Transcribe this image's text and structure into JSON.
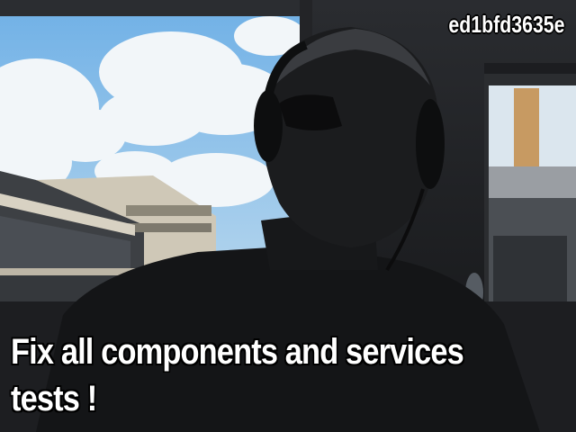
{
  "photo": {
    "caption": {
      "line1": "Fix all components and services",
      "line2": "tests !"
    },
    "watermark_id": "ed1bfd3635e",
    "colors": {
      "sky": "#8fc3ea",
      "cloud": "#f3f6f8",
      "shadow": "#121315",
      "building": "#c9c2b2",
      "chimney": "#c9a06a",
      "caption_text": "#ffffff"
    }
  }
}
